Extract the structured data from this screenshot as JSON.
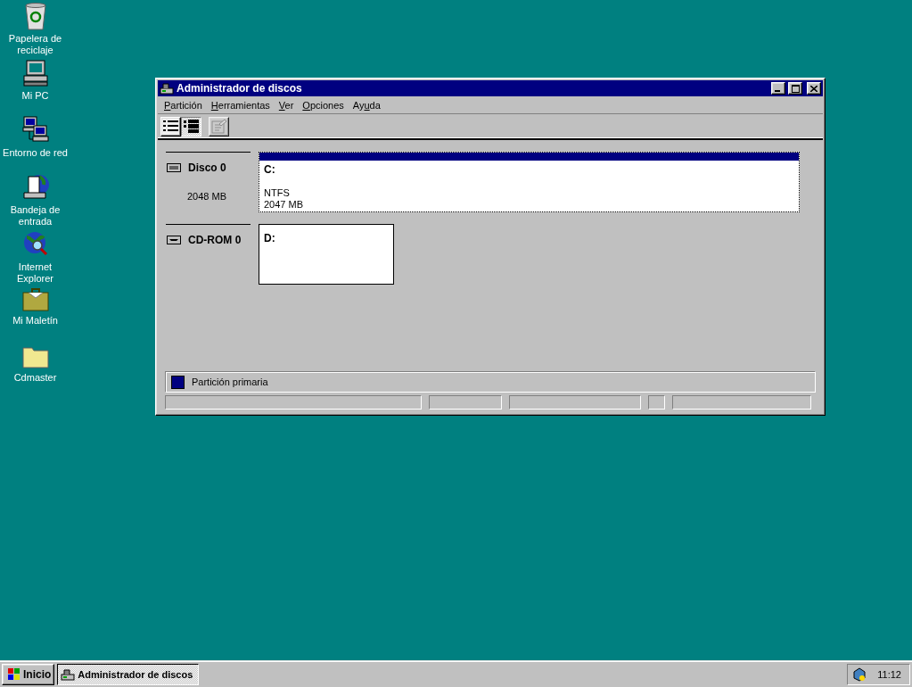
{
  "desktop_icons": [
    {
      "label": "Papelera de reciclaje",
      "kind": "recycle"
    },
    {
      "label": "Mi PC",
      "kind": "computer"
    },
    {
      "label": "Entorno de red",
      "kind": "network"
    },
    {
      "label": "Bandeja de entrada",
      "kind": "inbox"
    },
    {
      "label": "Internet Explorer",
      "kind": "globe"
    },
    {
      "label": "Mi Maletín",
      "kind": "briefcase"
    },
    {
      "label": "Cdmaster",
      "kind": "folder"
    }
  ],
  "window": {
    "title": "Administrador de discos",
    "menu": [
      {
        "parts": [
          {
            "text": "P",
            "underlined": true
          },
          {
            "text": "artición",
            "underlined": false
          }
        ]
      },
      {
        "parts": [
          {
            "text": "H",
            "underlined": true
          },
          {
            "text": "erramientas",
            "underlined": false
          }
        ]
      },
      {
        "parts": [
          {
            "text": "V",
            "underlined": true
          },
          {
            "text": "er",
            "underlined": false
          }
        ]
      },
      {
        "parts": [
          {
            "text": "O",
            "underlined": true
          },
          {
            "text": "pciones",
            "underlined": false
          }
        ]
      },
      {
        "parts": [
          {
            "text": "Ay",
            "underlined": false
          },
          {
            "text": "u",
            "underlined": true
          },
          {
            "text": "da",
            "underlined": false
          }
        ]
      }
    ],
    "toolbar": [
      {
        "kind": "list",
        "selected": false,
        "disabled": false
      },
      {
        "kind": "tree",
        "selected": true,
        "disabled": false
      },
      {
        "kind": "properties",
        "selected": false,
        "disabled": true
      }
    ],
    "disks": [
      {
        "name": "Disco 0",
        "kind": "hard",
        "size": "2048 MB",
        "partitions": [
          {
            "letter": "C:",
            "fs": "NTFS",
            "size": "2047 MB",
            "color": "#000080",
            "selected": true
          }
        ]
      },
      {
        "name": "CD-ROM 0",
        "kind": "cdrom",
        "partitions": [
          {
            "letter": "D:",
            "selected": false
          }
        ]
      }
    ],
    "legend": [
      {
        "label": "Partición primaria",
        "color": "#000080"
      }
    ]
  },
  "taskbar": {
    "start": "Inicio",
    "tasks": [
      {
        "label": "Administrador de discos",
        "selected": true
      }
    ],
    "clock": "11:12"
  }
}
